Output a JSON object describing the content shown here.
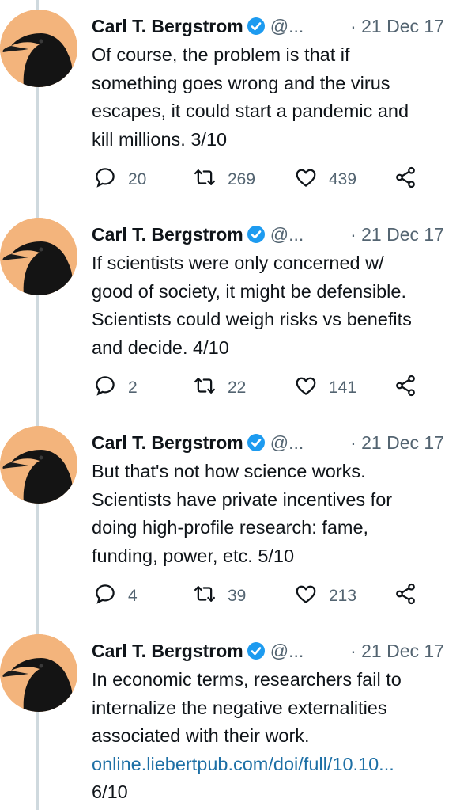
{
  "tweets": [
    {
      "name": "Carl T. Bergstrom",
      "handle": "@...",
      "date": "· 21 Dec 17",
      "lines": [
        "Of course, the problem is that if",
        "something goes wrong and the virus",
        "escapes, it could start a pandemic and",
        "kill millions. 3/10"
      ],
      "replies": "20",
      "retweets": "269",
      "likes": "439"
    },
    {
      "name": "Carl T. Bergstrom",
      "handle": "@...",
      "date": "· 21 Dec 17",
      "lines": [
        "If scientists were only concerned w/",
        "good of society, it might be defensible.",
        "Scientists could weigh risks vs benefits",
        "and decide. 4/10"
      ],
      "replies": "2",
      "retweets": "22",
      "likes": "141"
    },
    {
      "name": "Carl T. Bergstrom",
      "handle": "@...",
      "date": "· 21 Dec 17",
      "lines": [
        "But that's not how science works.",
        "Scientists have private incentives for",
        "doing high-profile research: fame,",
        "funding, power, etc. 5/10"
      ],
      "replies": "4",
      "retweets": "39",
      "likes": "213"
    },
    {
      "name": "Carl T. Bergstrom",
      "handle": "@...",
      "date": "· 21 Dec 17",
      "lines": [
        "In economic terms, researchers fail to",
        "internalize the negative externalities",
        "associated with their work."
      ],
      "link": "online.liebertpub.com/doi/full/10.10...",
      "tail": "6/10"
    }
  ],
  "icons": {
    "reply": "reply-icon",
    "retweet": "retweet-icon",
    "like": "heart-icon",
    "share": "share-icon",
    "verified": "verified-badge-icon"
  },
  "colors": {
    "text": "#0f1419",
    "secondary": "#536471",
    "link": "#1d6fa5",
    "verified": "#1d9bf0",
    "thread_line": "#cfd9de",
    "avatar_bg": "#f3b47c"
  }
}
